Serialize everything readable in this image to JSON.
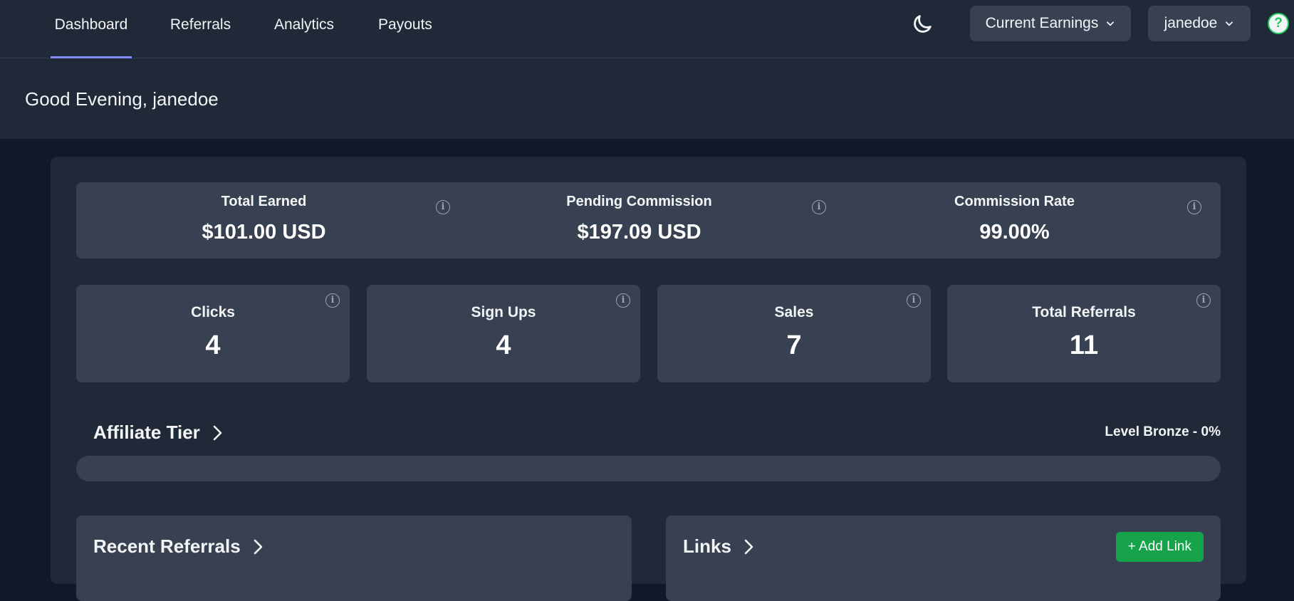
{
  "nav": {
    "tabs": [
      {
        "label": "Dashboard",
        "active": true
      },
      {
        "label": "Referrals",
        "active": false
      },
      {
        "label": "Analytics",
        "active": false
      },
      {
        "label": "Payouts",
        "active": false
      }
    ],
    "theme_toggle_icon": "moon-icon",
    "earnings_dropdown": "Current Earnings",
    "user_dropdown": "janedoe",
    "help_icon": "help-circle-icon",
    "help_glyph": "?",
    "accent_color": "#818cf8",
    "help_color": "#22c55e"
  },
  "header": {
    "greeting": "Good Evening, janedoe"
  },
  "summary": [
    {
      "label": "Total Earned",
      "value": "$101.00 USD"
    },
    {
      "label": "Pending Commission",
      "value": "$197.09 USD"
    },
    {
      "label": "Commission Rate",
      "value": "99.00%"
    }
  ],
  "stats": [
    {
      "label": "Clicks",
      "value": "4"
    },
    {
      "label": "Sign Ups",
      "value": "4"
    },
    {
      "label": "Sales",
      "value": "7"
    },
    {
      "label": "Total Referrals",
      "value": "11"
    }
  ],
  "tier": {
    "title": "Affiliate Tier",
    "level_text": "Level Bronze - 0%",
    "progress_fraction": 0
  },
  "recent_referrals": {
    "title": "Recent Referrals"
  },
  "links": {
    "title": "Links",
    "add_button": "+ Add Link",
    "add_button_color": "#16a34a"
  },
  "info_glyph": "i"
}
